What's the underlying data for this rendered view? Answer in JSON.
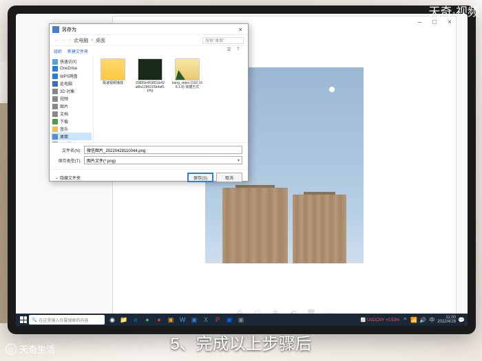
{
  "watermarks": {
    "top_right": "天奇·视频",
    "bottom_left": "天奇生活",
    "bl_icon": "Q"
  },
  "subtitle": "5、完成以上步骤后",
  "viewer": {
    "close": "×",
    "max": "□",
    "min": "–"
  },
  "dialog": {
    "title": "另存为",
    "close": "×",
    "nav": {
      "back": "←",
      "fwd": "→",
      "up": "↑",
      "path_sep": "›",
      "path1": "此电脑",
      "path2": "桌面",
      "search": "搜索\"桌面\""
    },
    "toolbar": {
      "organize": "组织",
      "new_folder": "新建文件夹"
    },
    "sidebar": [
      {
        "label": "快速访问",
        "cls": "sb-star"
      },
      {
        "label": "OneDrive",
        "cls": "sb-cloud"
      },
      {
        "label": "WPS网盘",
        "cls": "sb-cloud"
      },
      {
        "label": "此电脑",
        "cls": "sb-pc"
      },
      {
        "label": "3D 对象",
        "cls": "sb-gray"
      },
      {
        "label": "视频",
        "cls": "sb-gray"
      },
      {
        "label": "图片",
        "cls": "sb-gray"
      },
      {
        "label": "文档",
        "cls": "sb-gray"
      },
      {
        "label": "下载",
        "cls": "sb-green"
      },
      {
        "label": "音乐",
        "cls": "sb-yellow"
      },
      {
        "label": "桌面",
        "cls": "sb-blue",
        "sel": true
      },
      {
        "label": "本地磁盘",
        "cls": "sb-gray"
      }
    ],
    "files": [
      {
        "label": "极速视频播放",
        "type": "folder"
      },
      {
        "label": "29859e4f18f31b42a8fa1286315b4af0.png",
        "type": "img1"
      },
      {
        "label": "tiang_video (192.168.1.8) 快捷方式",
        "type": "img2"
      }
    ],
    "filename_label": "文件名(N):",
    "filename_value": "微信图片_20220428110044.png",
    "filetype_label": "保存类型(T):",
    "filetype_value": "图片文件(*.png)",
    "hide_folders": "隐藏文件夹",
    "save_btn": "保存(S)",
    "cancel_btn": "取消"
  },
  "taskbar": {
    "search_placeholder": "在这里输入你要搜索的内容",
    "apps": [
      {
        "c": "#fff",
        "t": "◉"
      },
      {
        "c": "#ffd54a",
        "t": "📁"
      },
      {
        "c": "#0078d4",
        "t": "e"
      },
      {
        "c": "#3cc45a",
        "t": "●"
      },
      {
        "c": "#e04040",
        "t": "●"
      },
      {
        "c": "#f0a030",
        "t": "▣"
      },
      {
        "c": "#40a0e0",
        "t": "W"
      },
      {
        "c": "#3080d0",
        "t": "▣"
      },
      {
        "c": "#4a8",
        "t": "X"
      },
      {
        "c": "#d44",
        "t": "P"
      },
      {
        "c": "#06f",
        "t": "▣"
      },
      {
        "c": "#888",
        "t": "▣"
      }
    ],
    "stock": "USDCNY +0.53%",
    "time": "11:00",
    "date": "2022/4/28"
  }
}
